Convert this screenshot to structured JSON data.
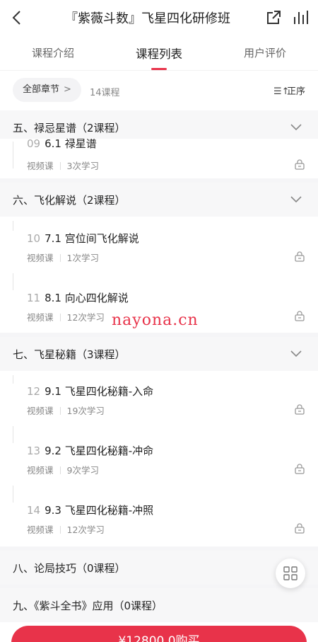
{
  "header": {
    "title": "『紫薇斗数』飞星四化研修班"
  },
  "tabs": [
    "课程介绍",
    "课程列表",
    "用户评价"
  ],
  "filter": {
    "chapter_label": "全部章节",
    "chapter_chevron": ">",
    "lesson_count": "14课程",
    "sort_label": "正序"
  },
  "chapters": [
    {
      "title": "五、禄忌星谱（2课程）"
    },
    {
      "title": "六、飞化解说（2课程）"
    },
    {
      "title": "七、飞星秘籍（3课程）"
    },
    {
      "title": "八、论局技巧（0课程）"
    },
    {
      "title": "九、《紫斗全书》应用（0课程）"
    }
  ],
  "lessons": [
    {
      "num": "09",
      "title": "6.1 禄星谱",
      "type": "视频课",
      "views": "3次学习"
    },
    {
      "num": "10",
      "title": "7.1 宫位间飞化解说",
      "type": "视频课",
      "views": "1次学习"
    },
    {
      "num": "11",
      "title": "8.1 向心四化解说",
      "type": "视频课",
      "views": "12次学习"
    },
    {
      "num": "12",
      "title": "9.1 飞星四化秘籍-入命",
      "type": "视频课",
      "views": "19次学习"
    },
    {
      "num": "13",
      "title": "9.2 飞星四化秘籍-冲命",
      "type": "视频课",
      "views": "9次学习"
    },
    {
      "num": "14",
      "title": "9.3 飞星四化秘籍-冲照",
      "type": "视频课",
      "views": "12次学习"
    }
  ],
  "watermark": "nayona.cn",
  "buy_button": "¥12800.0购买",
  "colors": {
    "accent": "#e8334a",
    "section_bg": "#f7f7f8",
    "muted": "#888888"
  }
}
